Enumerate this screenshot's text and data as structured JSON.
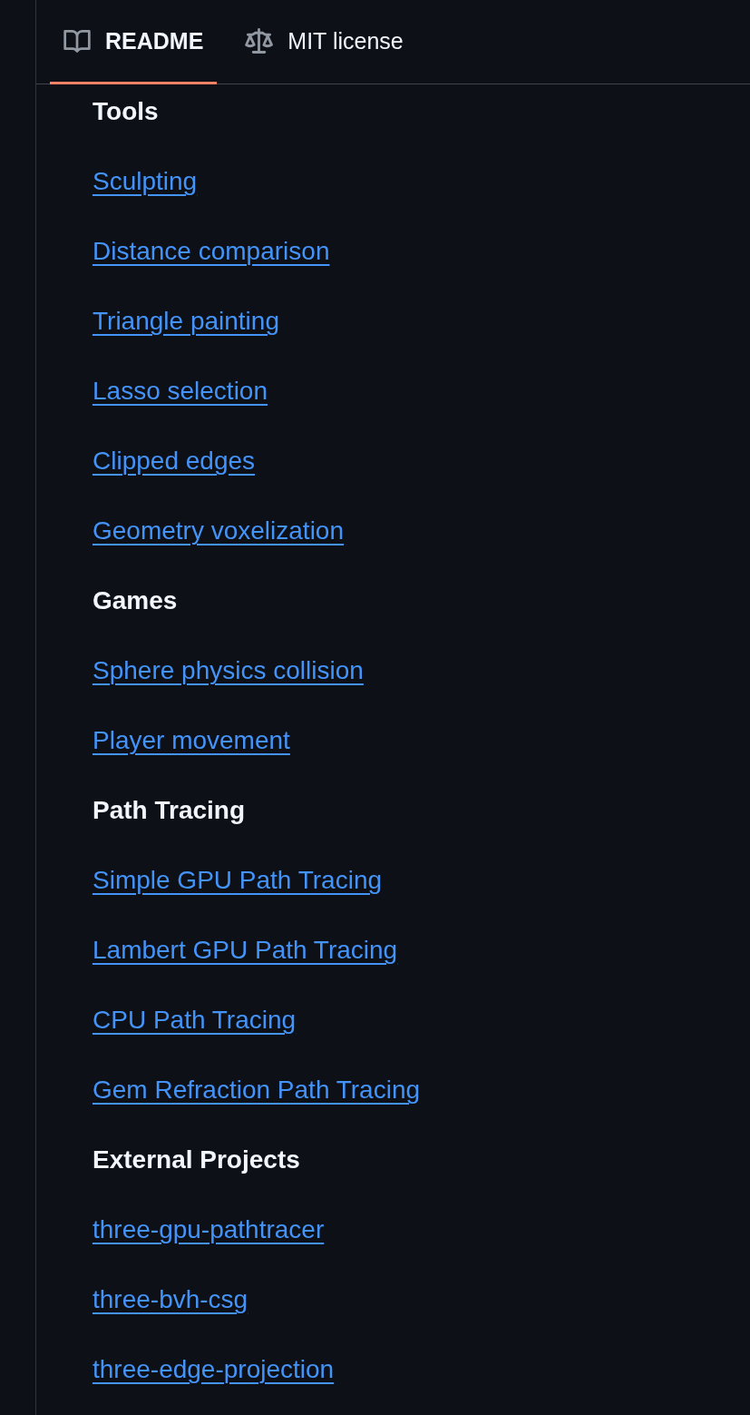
{
  "tabs": [
    {
      "label": "README",
      "selected": true
    },
    {
      "label": "MIT license",
      "selected": false
    }
  ],
  "readme": {
    "sections": [
      {
        "heading": "Tools",
        "links": [
          "Sculpting",
          "Distance comparison",
          "Triangle painting",
          "Lasso selection",
          "Clipped edges",
          "Geometry voxelization"
        ]
      },
      {
        "heading": "Games",
        "links": [
          "Sphere physics collision",
          "Player movement"
        ]
      },
      {
        "heading": "Path Tracing",
        "links": [
          "Simple GPU Path Tracing",
          "Lambert GPU Path Tracing",
          "CPU Path Tracing",
          "Gem Refraction Path Tracing"
        ]
      },
      {
        "heading": "External Projects",
        "links": [
          "three-gpu-pathtracer",
          "three-bvh-csg",
          "three-edge-projection"
        ]
      }
    ]
  }
}
